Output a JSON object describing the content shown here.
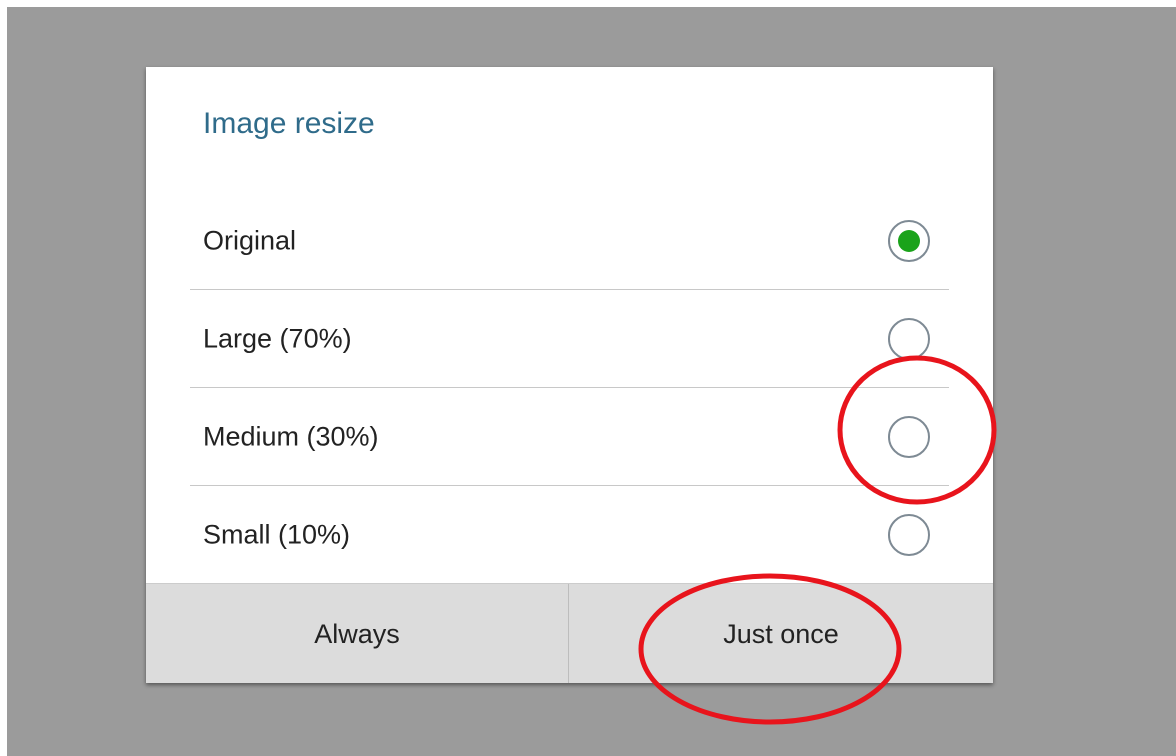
{
  "dialog": {
    "title": "Image resize",
    "options": [
      {
        "label": "Original",
        "selected": true
      },
      {
        "label": "Large (70%)",
        "selected": false
      },
      {
        "label": "Medium (30%)",
        "selected": false
      },
      {
        "label": "Small (10%)",
        "selected": false
      }
    ],
    "buttons": {
      "always": "Always",
      "just_once": "Just once"
    }
  },
  "colors": {
    "title": "#2f6b8a",
    "radio_selected": "#1aa31a",
    "annotation": "#e8141c",
    "backdrop": "#9b9b9b"
  }
}
